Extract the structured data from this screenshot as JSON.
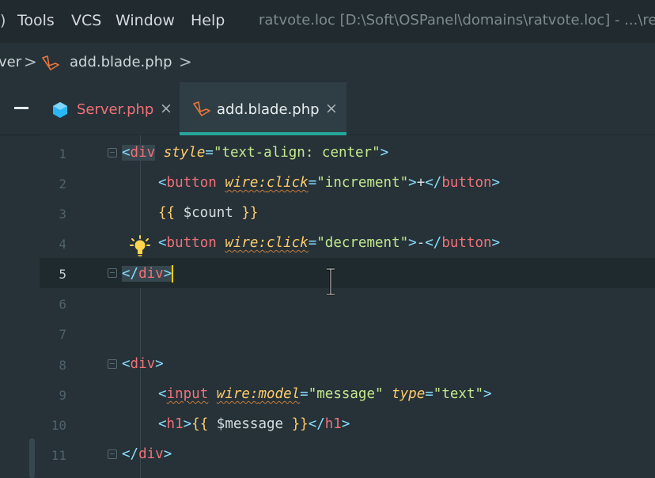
{
  "menu": {
    "left_edge": ")",
    "items": [
      {
        "label": "Tools"
      },
      {
        "label": "VCS"
      },
      {
        "label": "Window"
      },
      {
        "label": "Help"
      }
    ],
    "window_title": "ratvote.loc [D:\\Soft\\OSPanel\\domains\\ratvote.loc] - ...\\re"
  },
  "breadcrumb": {
    "items": [
      "ver",
      "add.blade.php"
    ],
    "separator": ">"
  },
  "tabs": [
    {
      "label": "Server.php",
      "close": "×",
      "icon": "php-file-icon",
      "color": "#f07178"
    },
    {
      "label": "add.blade.php",
      "close": "×",
      "icon": "laravel-blade-icon",
      "color": "#e8eef0"
    }
  ],
  "editor": {
    "lines": [
      {
        "n": "1"
      },
      {
        "n": "2"
      },
      {
        "n": "3"
      },
      {
        "n": "4"
      },
      {
        "n": "5"
      },
      {
        "n": "6"
      },
      {
        "n": "7"
      },
      {
        "n": "8"
      },
      {
        "n": "9"
      },
      {
        "n": "10"
      },
      {
        "n": "11"
      }
    ],
    "tokens": {
      "lt": "<",
      "gt": ">",
      "lt_slash": "</",
      "eq": "=",
      "colon": ":",
      "div": "div",
      "button": "button",
      "input": "input",
      "h1": "h1",
      "style": "style",
      "style_val": "\"text-align: center\"",
      "wire": "wire",
      "click": "click",
      "model": "model",
      "type": "type",
      "increment": "\"increment\"",
      "decrement": "\"decrement\"",
      "message_str": "\"message\"",
      "text_str": "\"text\"",
      "plus": "+",
      "minus": "-",
      "open_brace": "{{",
      "close_brace": "}}",
      "count": " $count ",
      "message_var": " $message "
    }
  },
  "colors": {
    "accent": "#26a69a",
    "tag": "#f07178",
    "attribute": "#ffcb6b",
    "string": "#c3e88d",
    "caret": "#ffcc00"
  }
}
